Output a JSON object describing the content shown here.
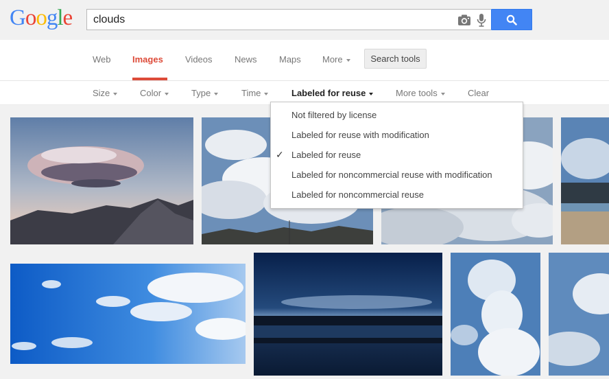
{
  "logo": {
    "letters": [
      "G",
      "o",
      "o",
      "g",
      "l",
      "e"
    ],
    "colors": [
      "#4285f4",
      "#ea4335",
      "#fbbc05",
      "#4285f4",
      "#34a853",
      "#ea4335"
    ]
  },
  "search": {
    "query": "clouds",
    "camera_icon": "camera-icon",
    "mic_icon": "microphone-icon",
    "button_icon": "search-icon"
  },
  "tabs": [
    {
      "label": "Web"
    },
    {
      "label": "Images"
    },
    {
      "label": "Videos"
    },
    {
      "label": "News"
    },
    {
      "label": "Maps"
    },
    {
      "label": "More"
    }
  ],
  "search_tools_label": "Search tools",
  "tools": [
    {
      "label": "Size"
    },
    {
      "label": "Color"
    },
    {
      "label": "Type"
    },
    {
      "label": "Time"
    },
    {
      "label": "Labeled for reuse"
    },
    {
      "label": "More tools"
    },
    {
      "label": "Clear"
    }
  ],
  "license_menu": {
    "items": [
      {
        "label": "Not filtered by license",
        "checked": false
      },
      {
        "label": "Labeled for reuse with modification",
        "checked": false
      },
      {
        "label": "Labeled for reuse",
        "checked": true
      },
      {
        "label": "Labeled for noncommercial reuse with modification",
        "checked": false
      },
      {
        "label": "Labeled for noncommercial reuse",
        "checked": false
      }
    ],
    "check_mark": "✓"
  },
  "colors": {
    "accent_red": "#dd4b39",
    "search_blue": "#4285f4"
  }
}
